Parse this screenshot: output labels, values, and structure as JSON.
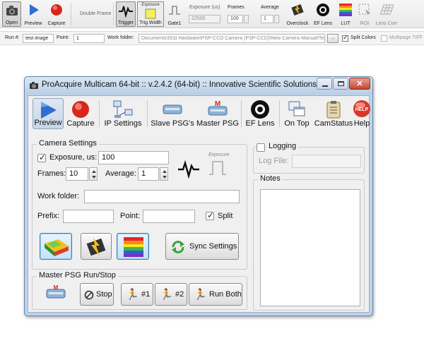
{
  "ribbon": {
    "open_label": "Open",
    "preview_label": "Preview",
    "capture_label": "Capture",
    "double_frame_label": "Double Frame",
    "trigger_label": "Trigger",
    "trig_width_label": "Trig.Width",
    "trig_width_caption": "Exposure",
    "gate1_label": "Gate1",
    "exposure_label": "Exposure (us)",
    "exposure_value": "22500",
    "frames_label": "Frames",
    "frames_value": "100",
    "average_label": "Average",
    "average_value": "1",
    "overclock_label": "Overclock",
    "ef_lens_label": "EF Lens",
    "lut_label": "LUT",
    "roi_label": "ROI",
    "lens_corr_label": "Lens Corr"
  },
  "strip": {
    "run_label": "Run #:",
    "run_value": "test image",
    "point_label": "Point:",
    "point_value": "1",
    "work_folder_label": "Work folder:",
    "work_folder_value": "Documents\\ISSI Hardware\\PSP-CCD Camera (PSP-CCD)\\New Camera Manual\\Test",
    "browse_label": "...",
    "split_colors_label": "Split Colors",
    "multipage_label": "Multipage TIFF"
  },
  "window": {
    "title": "ProAcquire Multicam 64-bit :: v.2.4.2 (64-bit)  ::  Innovative Scientific Solutions...",
    "toolbar": {
      "preview": "Preview",
      "capture": "Capture",
      "ip_settings": "IP Settings",
      "slave_psg": "Slave PSG's",
      "master_psg": "Master PSG",
      "ef_lens": "EF Lens",
      "on_top": "On Top",
      "cam_status": "CamStatus",
      "help": "Help"
    },
    "camera_settings": {
      "title": "Camera Settings",
      "exposure_label": "Exposure, us:",
      "exposure_value": "100",
      "frames_label": "Frames:",
      "frames_value": "10",
      "average_label": "Average:",
      "average_value": "1",
      "exposure_icon_caption": "Exposure",
      "work_folder_label": "Work folder:",
      "work_folder_value": "",
      "prefix_label": "Prefix:",
      "prefix_value": "",
      "point_label": "Point:",
      "point_value": "",
      "split_label": "Split",
      "sync_label": "Sync Settings"
    },
    "master_psg": {
      "title": "Master PSG Run/Stop",
      "stop_label": "Stop",
      "run1_label": "#1",
      "run2_label": "#2",
      "run_both_label": "Run Both"
    },
    "logging": {
      "label": "Logging",
      "log_file_label": "Log File:",
      "log_file_value": ""
    },
    "notes": {
      "title": "Notes"
    },
    "help_badge": "HELP",
    "master_badge": "M"
  },
  "colors": {
    "accent_blue": "#2f6fd0",
    "capture_red": "#d9261c",
    "window_frame": "#bcd3ea",
    "help_red": "#d8372b"
  }
}
